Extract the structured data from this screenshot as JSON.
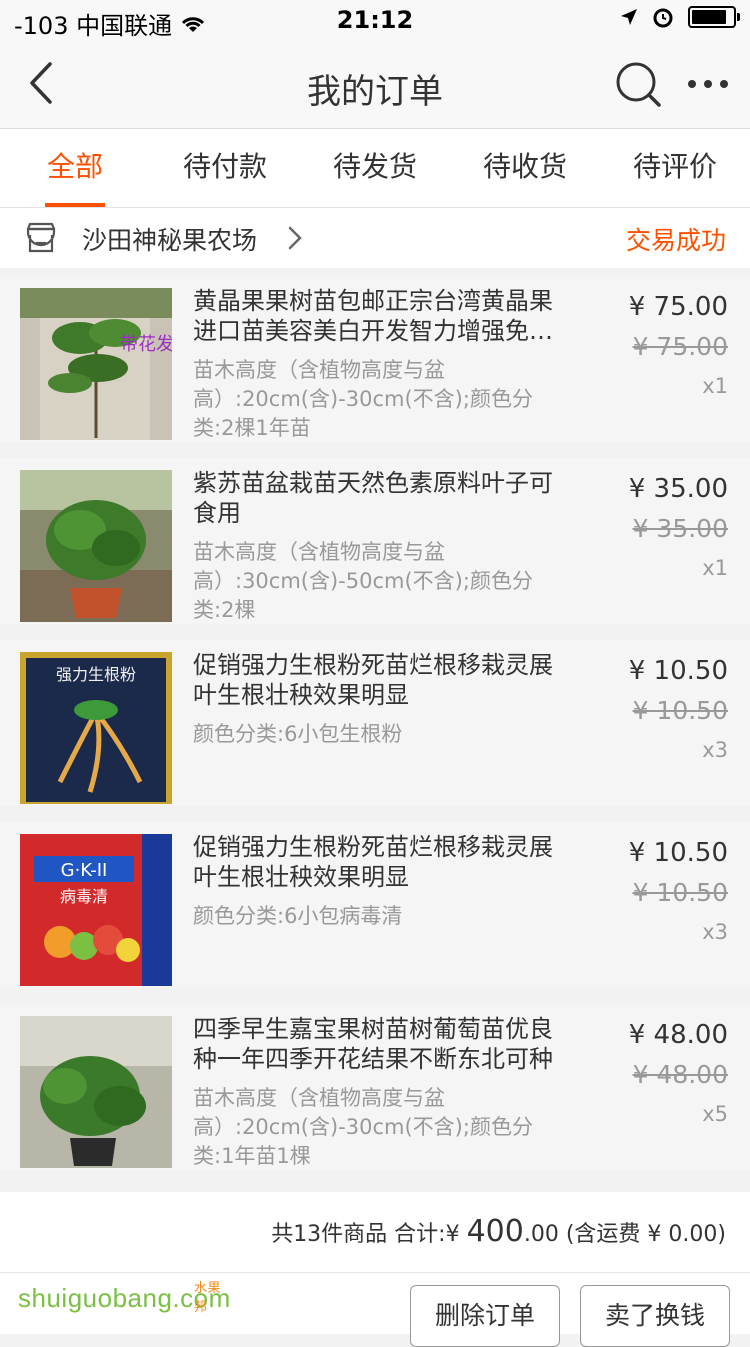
{
  "status_bar": {
    "carrier": "-103 中国联通",
    "time": "21:12"
  },
  "nav": {
    "title": "我的订单"
  },
  "tabs": [
    {
      "label": "全部",
      "active": true
    },
    {
      "label": "待付款",
      "active": false
    },
    {
      "label": "待发货",
      "active": false
    },
    {
      "label": "待收货",
      "active": false
    },
    {
      "label": "待评价",
      "active": false
    }
  ],
  "shop": {
    "name": "沙田神秘果农场",
    "status": "交易成功"
  },
  "items": [
    {
      "title": "黄晶果果树苗包邮正宗台湾黄晶果进口苗美容美白开发智力增强免疫力",
      "spec": "苗木高度（含植物高度与盆高）:20cm(含)-30cm(不含);颜色分类:2棵1年苗",
      "price": "¥ 75.00",
      "original_price": "¥ 75.00",
      "qty": "x1",
      "thumb_text": "带花发货"
    },
    {
      "title": "紫苏苗盆栽苗天然色素原料叶子可食用",
      "spec": "苗木高度（含植物高度与盆高）:30cm(含)-50cm(不含);颜色分类:2棵",
      "price": "¥ 35.00",
      "original_price": "¥ 35.00",
      "qty": "x1"
    },
    {
      "title": "促销强力生根粉死苗烂根移栽灵展叶生根壮秧效果明显",
      "spec": "颜色分类:6小包生根粉",
      "price": "¥ 10.50",
      "original_price": "¥ 10.50",
      "qty": "x3",
      "thumb_text": "强力生根粉"
    },
    {
      "title": "促销强力生根粉死苗烂根移栽灵展叶生根壮秧效果明显",
      "spec": "颜色分类:6小包病毒清",
      "price": "¥ 10.50",
      "original_price": "¥ 10.50",
      "qty": "x3",
      "thumb_text": "G·K-II",
      "thumb_text2": "病毒清"
    },
    {
      "title": "四季早生嘉宝果树苗树葡萄苗优良种一年四季开花结果不断东北可种",
      "spec": "苗木高度（含植物高度与盆高）:20cm(含)-30cm(不含);颜色分类:1年苗1棵",
      "price": "¥ 48.00",
      "original_price": "¥ 48.00",
      "qty": "x5"
    }
  ],
  "summary": {
    "count_text": "共13件商品 合计:",
    "total_currency": "¥ ",
    "total_int": "400",
    "total_dec": ".00",
    "shipping_text": " (含运费 ¥ 0.00)"
  },
  "footer": {
    "delete_label": "删除订单",
    "sell_label": "卖了换钱",
    "watermark": "shuiguobang",
    "watermark_suffix": ".com",
    "watermark_sub": "水果邦"
  },
  "colors": {
    "accent": "#ff5000",
    "watermark": "#7bc043"
  }
}
